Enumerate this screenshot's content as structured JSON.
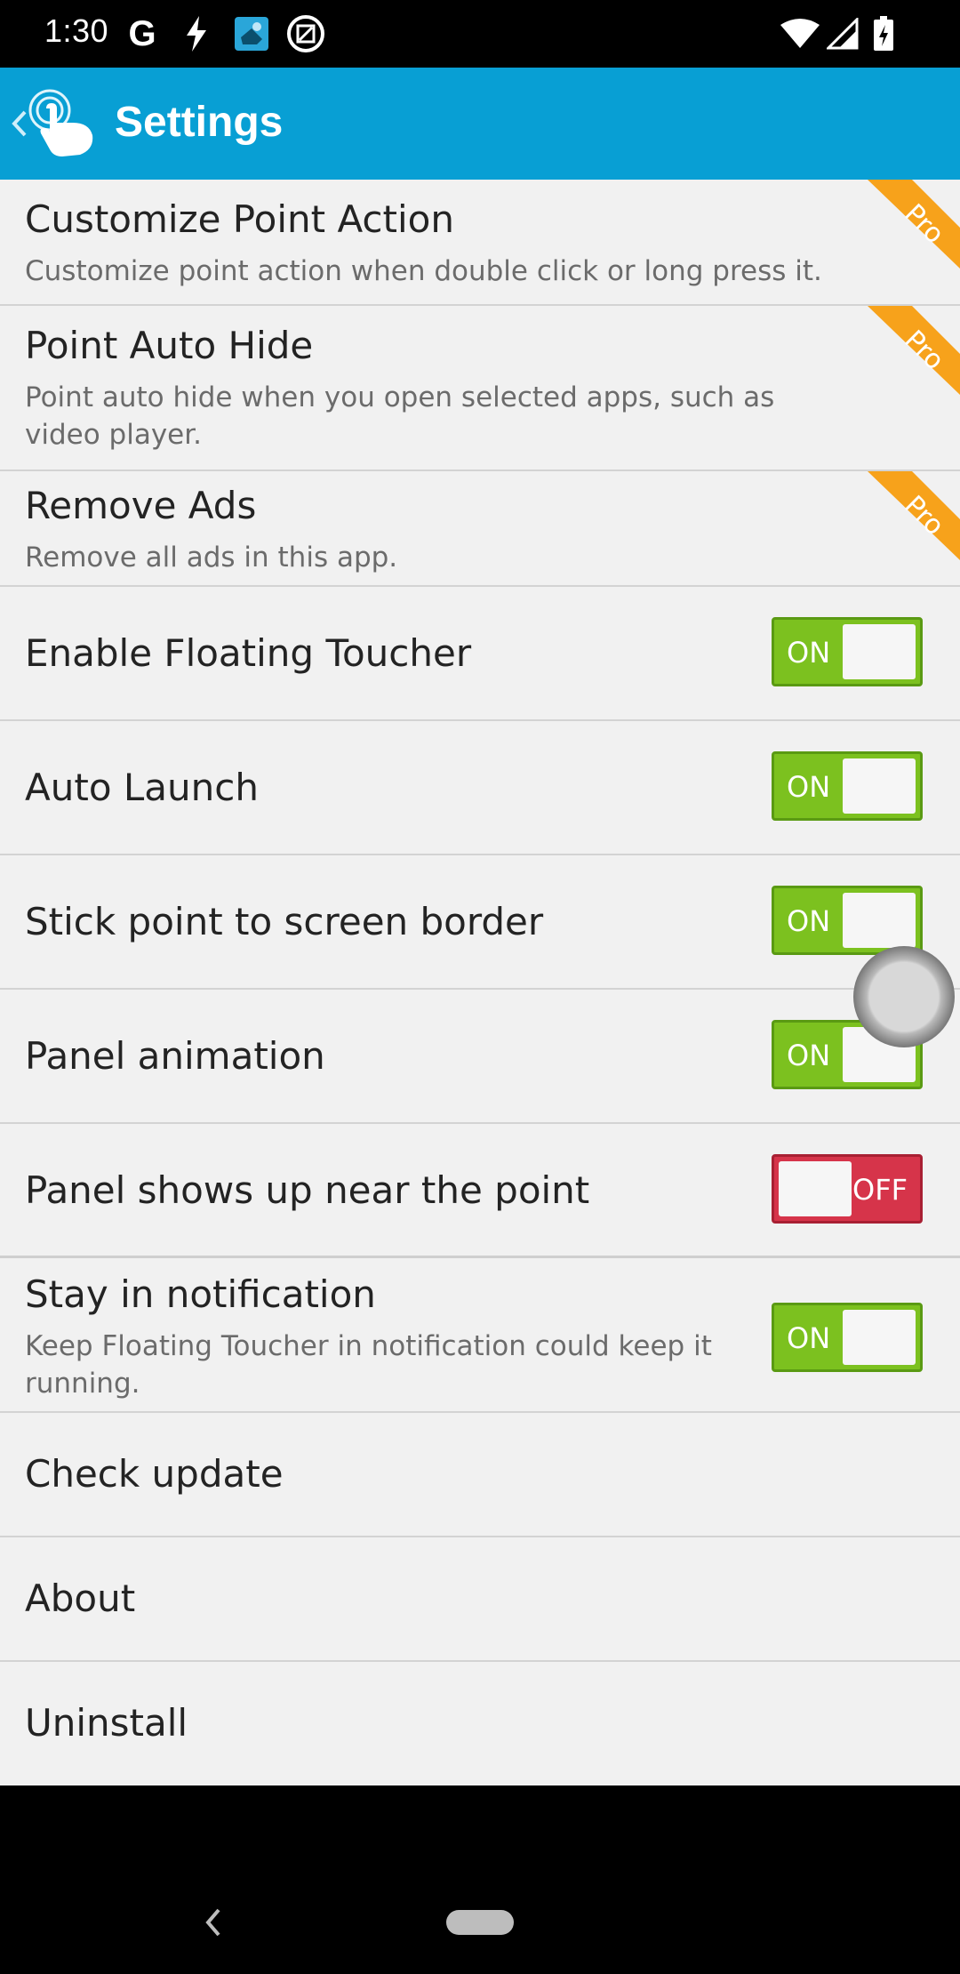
{
  "status_bar": {
    "time": "1:30",
    "google_icon": "G"
  },
  "app_bar": {
    "title": "Settings"
  },
  "rows": [
    {
      "title": "Customize Point Action",
      "subtitle": "Customize point action when double click or long press it.",
      "badge": "Pro"
    },
    {
      "title": "Point Auto Hide",
      "subtitle": "Point auto hide when you open selected apps, such as video player.",
      "badge": "Pro"
    },
    {
      "title": "Remove Ads",
      "subtitle": "Remove all ads in this app.",
      "badge": "Pro"
    },
    {
      "title": "Enable Floating Toucher",
      "toggle": "ON"
    },
    {
      "title": "Auto Launch",
      "toggle": "ON"
    },
    {
      "title": "Stick point to screen border",
      "toggle": "ON"
    },
    {
      "title": "Panel animation",
      "toggle": "ON"
    },
    {
      "title": "Panel shows up near the point",
      "toggle": "OFF"
    },
    {
      "title": "Stay in notification",
      "subtitle": "Keep Floating Toucher in notification could keep it running.",
      "toggle": "ON"
    },
    {
      "title": "Check update"
    },
    {
      "title": "About"
    },
    {
      "title": "Uninstall"
    }
  ],
  "colors": {
    "app_bar": "#089fd4",
    "toggle_on": "#7cc11f",
    "toggle_off": "#d6344a",
    "pro_ribbon": "#f7a21b"
  }
}
